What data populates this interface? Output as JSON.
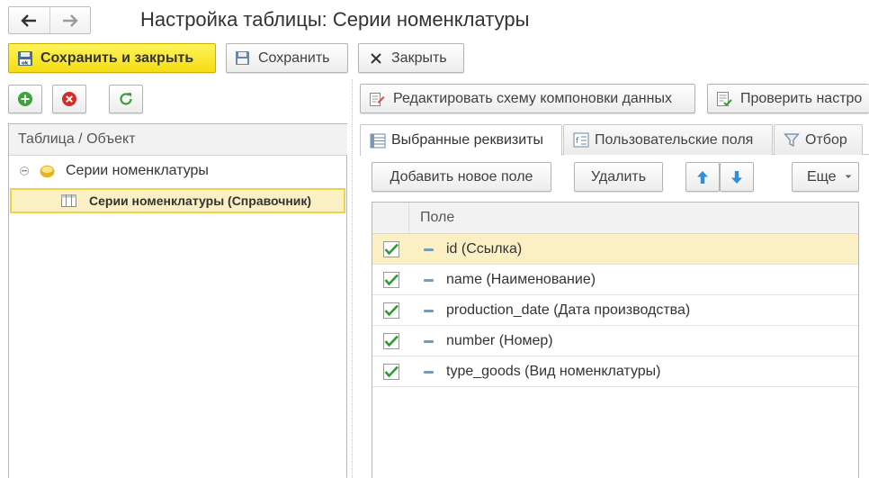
{
  "window": {
    "title": "Настройка таблицы: Серии номенклатуры"
  },
  "toolbar": {
    "save_close_label": "Сохранить и закрыть",
    "save_label": "Сохранить",
    "close_label": "Закрыть"
  },
  "tree": {
    "header": "Таблица / Объект",
    "items": [
      {
        "label": "Серии номенклатуры"
      },
      {
        "label": "Серии номенклатуры (Справочник)"
      }
    ]
  },
  "right_toolbar": {
    "edit_schema_label": "Редактировать схему компоновки данных",
    "check_label": "Проверить настро"
  },
  "tabs": [
    {
      "label": "Выбранные реквизиты"
    },
    {
      "label": "Пользовательские поля"
    },
    {
      "label": "Отбор"
    }
  ],
  "fields_toolbar": {
    "add_label": "Добавить новое поле",
    "delete_label": "Удалить",
    "more_label": "Еще"
  },
  "fields_table": {
    "column_header": "Поле",
    "rows": [
      {
        "label": "id (Ссылка)",
        "checked": true,
        "selected": true
      },
      {
        "label": "name (Наименование)",
        "checked": true
      },
      {
        "label": "production_date (Дата производства)",
        "checked": true
      },
      {
        "label": "number (Номер)",
        "checked": true
      },
      {
        "label": "type_goods (Вид номенклатуры)",
        "checked": true
      }
    ]
  },
  "colors": {
    "primary_button": "#f5dd12",
    "selection": "#fbf0c4",
    "check_green": "#2f9a34",
    "arrow_blue": "#2f8fd8"
  }
}
